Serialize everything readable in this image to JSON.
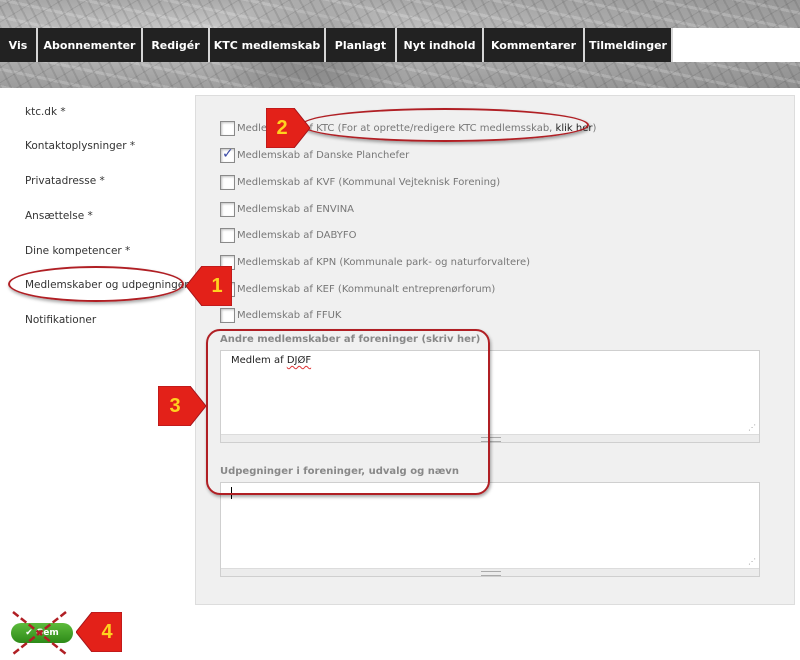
{
  "tabs": [
    "Vis",
    "Abonnementer",
    "Redigér",
    "KTC medlemskab",
    "Planlagt",
    "Nyt indhold",
    "Kommentarer",
    "Tilmeldinger"
  ],
  "sidebar": {
    "items": [
      "ktc.dk *",
      "Kontaktoplysninger *",
      "Privatadresse *",
      "Ansættelse *",
      "Dine kompetencer *",
      "Medlemskaber og udpegninger",
      "Notifikationer"
    ]
  },
  "memberships": {
    "ktc": {
      "label": "Medlemskab af KTC",
      "note": "(For at oprette/redigere KTC medlemsskab, ",
      "link": "klik her",
      "note_end": ")",
      "checked": false
    },
    "items": [
      {
        "label": "Medlemskab af Danske Planchefer",
        "checked": true
      },
      {
        "label": "Medlemskab af KVF (Kommunal Vejteknisk Forening)",
        "checked": false
      },
      {
        "label": "Medlemskab af ENVINA",
        "checked": false
      },
      {
        "label": "Medlemskab af DABYFO",
        "checked": false
      },
      {
        "label": "Medlemskab af KPN (Kommunale park- og naturforvaltere)",
        "checked": false
      },
      {
        "label": "Medlemskab af KEF (Kommunalt entreprenørforum)",
        "checked": false
      },
      {
        "label": "Medlemskab af FFUK",
        "checked": false
      }
    ]
  },
  "other_memberships": {
    "label": "Andre medlemskaber af foreninger (skriv her)",
    "value_prefix": "Medlem af ",
    "value_word": "DJØF"
  },
  "appointments": {
    "label": "Udpegninger i foreninger, udvalg og nævn",
    "value": ""
  },
  "save_label": "Gem",
  "annotations": [
    "1",
    "2",
    "3",
    "4"
  ],
  "colors": {
    "tab_bg": "#222222",
    "annotation_red": "#b01f24",
    "badge_red": "#e32119",
    "badge_text": "#ffd21f",
    "save_green": "#3c9e24"
  }
}
